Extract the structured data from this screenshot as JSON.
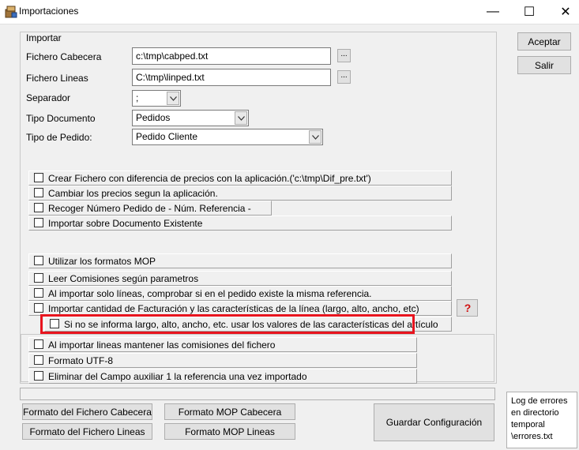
{
  "window": {
    "title": "Importaciones",
    "minimize": "—",
    "maximize": "☐",
    "close": "✕"
  },
  "group": {
    "label": "Importar"
  },
  "fields": {
    "cabecera": {
      "label": "Fichero Cabecera",
      "value": "c:\\tmp\\cabped.txt",
      "browse": "..."
    },
    "lineas": {
      "label": "Fichero Lineas",
      "value": "C:\\tmp\\linped.txt",
      "browse": "..."
    },
    "separador": {
      "label": "Separador",
      "value": ";"
    },
    "tipo_documento": {
      "label": "Tipo Documento",
      "value": "Pedidos"
    },
    "tipo_pedido": {
      "label": "Tipo de Pedido:",
      "value": "Pedido Cliente"
    }
  },
  "options1": [
    "Crear Fichero con diferencia de precios con la aplicación.('c:\\tmp\\Dif_pre.txt')",
    "Cambiar los precios segun la aplicación.",
    "Recoger Número Pedido de - Núm. Referencia -",
    "Importar sobre Documento Existente"
  ],
  "options2": [
    "Utilizar los formatos MOP",
    "Leer Comisiones según parametros",
    "Al importar solo líneas, comprobar si en el pedido existe la misma referencia.",
    "Importar cantidad de Facturación y las características de la línea (largo, alto, ancho, etc)"
  ],
  "sub_option": "Si no se informa largo, alto, ancho, etc. usar los valores de las características del artículo",
  "options3": [
    "Al importar lineas mantener las comisiones del fichero",
    "Formato UTF-8",
    "Eliminar del Campo auxiliar 1 la referencia una vez importado"
  ],
  "buttons": {
    "aceptar": "Aceptar",
    "salir": "Salir",
    "formato_cabecera": "Formato del Fichero Cabecera",
    "formato_lineas": "Formato del Fichero Lineas",
    "mop_cabecera": "Formato MOP Cabecera",
    "mop_lineas": "Formato MOP Lineas",
    "guardar": "Guardar Configuración"
  },
  "log": "Log de errores en directorio temporal \\errores.txt",
  "colors": {
    "highlight": "#e8141e",
    "help_icon": "#d01010"
  }
}
